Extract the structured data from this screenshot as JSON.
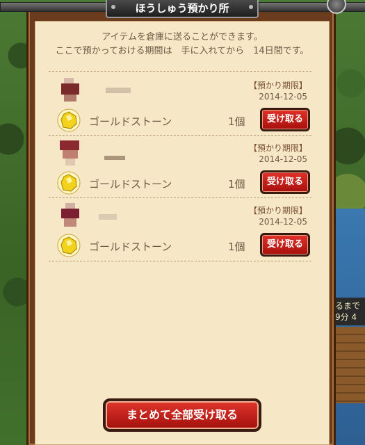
{
  "title": "ほうしゅう預かり所",
  "intro": {
    "line1": "アイテムを倉庫に送ることができます。",
    "line2": "ここで預かっておける期間は　手に入れてから　14日間です。"
  },
  "deadline_label": "【預かり期限】",
  "items": [
    {
      "deadline": "2014-12-05",
      "item_name": "ゴールドストーン",
      "qty": "1個",
      "button": "受け取る"
    },
    {
      "deadline": "2014-12-05",
      "item_name": "ゴールドストーン",
      "qty": "1個",
      "button": "受け取る"
    },
    {
      "deadline": "2014-12-05",
      "item_name": "ゴールドストーン",
      "qty": "1個",
      "button": "受け取る"
    }
  ],
  "receive_all_button": "まとめて全部受け取る",
  "background_sign": {
    "line1": "るまで",
    "line2": "9分 4"
  },
  "colors": {
    "button_red": "#c8201a",
    "panel": "#f6e7c6",
    "text": "#6e5a44"
  },
  "icons": {
    "item": "gold-stone-icon",
    "close": "close-icon"
  }
}
